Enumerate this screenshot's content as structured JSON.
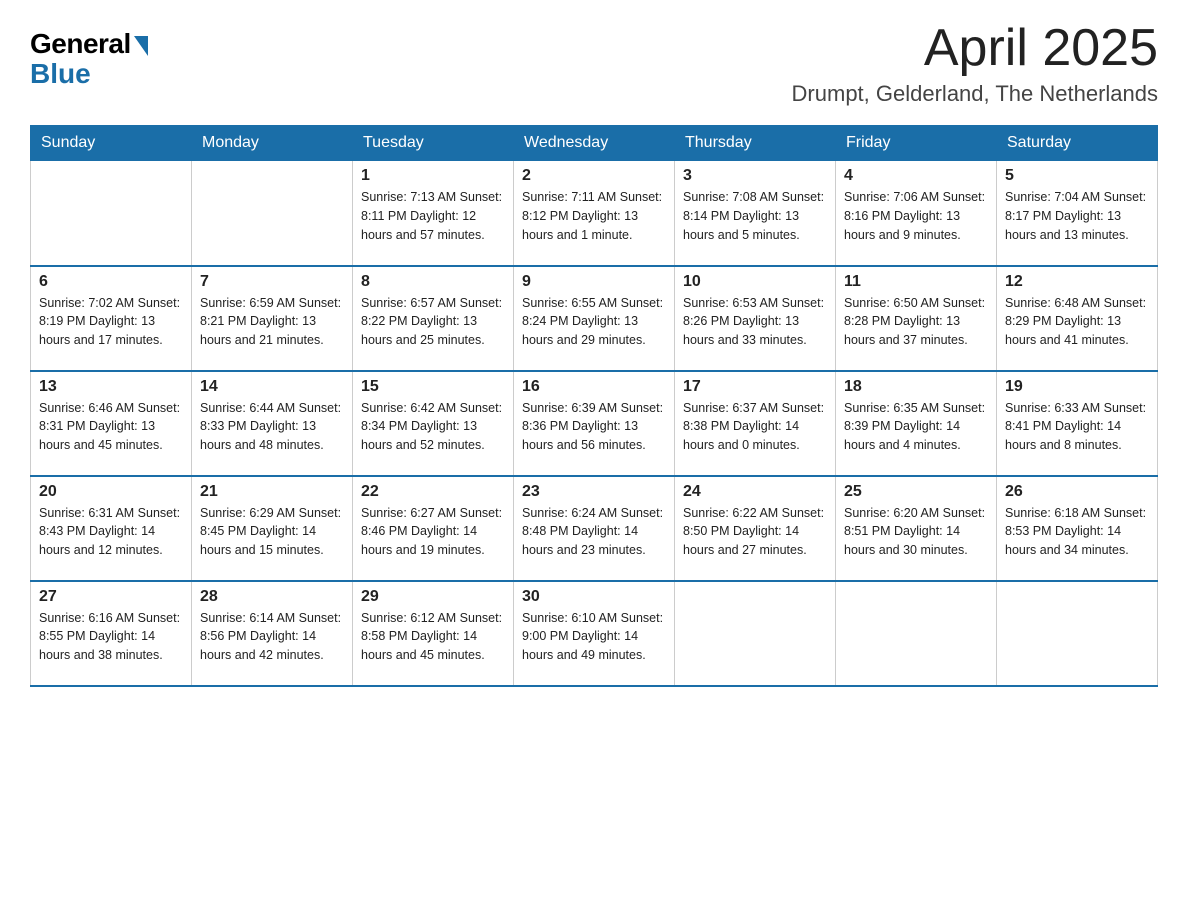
{
  "logo": {
    "general": "General",
    "blue": "Blue"
  },
  "title": "April 2025",
  "location": "Drumpt, Gelderland, The Netherlands",
  "weekdays": [
    "Sunday",
    "Monday",
    "Tuesday",
    "Wednesday",
    "Thursday",
    "Friday",
    "Saturday"
  ],
  "weeks": [
    [
      {
        "day": "",
        "info": ""
      },
      {
        "day": "",
        "info": ""
      },
      {
        "day": "1",
        "info": "Sunrise: 7:13 AM\nSunset: 8:11 PM\nDaylight: 12 hours\nand 57 minutes."
      },
      {
        "day": "2",
        "info": "Sunrise: 7:11 AM\nSunset: 8:12 PM\nDaylight: 13 hours\nand 1 minute."
      },
      {
        "day": "3",
        "info": "Sunrise: 7:08 AM\nSunset: 8:14 PM\nDaylight: 13 hours\nand 5 minutes."
      },
      {
        "day": "4",
        "info": "Sunrise: 7:06 AM\nSunset: 8:16 PM\nDaylight: 13 hours\nand 9 minutes."
      },
      {
        "day": "5",
        "info": "Sunrise: 7:04 AM\nSunset: 8:17 PM\nDaylight: 13 hours\nand 13 minutes."
      }
    ],
    [
      {
        "day": "6",
        "info": "Sunrise: 7:02 AM\nSunset: 8:19 PM\nDaylight: 13 hours\nand 17 minutes."
      },
      {
        "day": "7",
        "info": "Sunrise: 6:59 AM\nSunset: 8:21 PM\nDaylight: 13 hours\nand 21 minutes."
      },
      {
        "day": "8",
        "info": "Sunrise: 6:57 AM\nSunset: 8:22 PM\nDaylight: 13 hours\nand 25 minutes."
      },
      {
        "day": "9",
        "info": "Sunrise: 6:55 AM\nSunset: 8:24 PM\nDaylight: 13 hours\nand 29 minutes."
      },
      {
        "day": "10",
        "info": "Sunrise: 6:53 AM\nSunset: 8:26 PM\nDaylight: 13 hours\nand 33 minutes."
      },
      {
        "day": "11",
        "info": "Sunrise: 6:50 AM\nSunset: 8:28 PM\nDaylight: 13 hours\nand 37 minutes."
      },
      {
        "day": "12",
        "info": "Sunrise: 6:48 AM\nSunset: 8:29 PM\nDaylight: 13 hours\nand 41 minutes."
      }
    ],
    [
      {
        "day": "13",
        "info": "Sunrise: 6:46 AM\nSunset: 8:31 PM\nDaylight: 13 hours\nand 45 minutes."
      },
      {
        "day": "14",
        "info": "Sunrise: 6:44 AM\nSunset: 8:33 PM\nDaylight: 13 hours\nand 48 minutes."
      },
      {
        "day": "15",
        "info": "Sunrise: 6:42 AM\nSunset: 8:34 PM\nDaylight: 13 hours\nand 52 minutes."
      },
      {
        "day": "16",
        "info": "Sunrise: 6:39 AM\nSunset: 8:36 PM\nDaylight: 13 hours\nand 56 minutes."
      },
      {
        "day": "17",
        "info": "Sunrise: 6:37 AM\nSunset: 8:38 PM\nDaylight: 14 hours\nand 0 minutes."
      },
      {
        "day": "18",
        "info": "Sunrise: 6:35 AM\nSunset: 8:39 PM\nDaylight: 14 hours\nand 4 minutes."
      },
      {
        "day": "19",
        "info": "Sunrise: 6:33 AM\nSunset: 8:41 PM\nDaylight: 14 hours\nand 8 minutes."
      }
    ],
    [
      {
        "day": "20",
        "info": "Sunrise: 6:31 AM\nSunset: 8:43 PM\nDaylight: 14 hours\nand 12 minutes."
      },
      {
        "day": "21",
        "info": "Sunrise: 6:29 AM\nSunset: 8:45 PM\nDaylight: 14 hours\nand 15 minutes."
      },
      {
        "day": "22",
        "info": "Sunrise: 6:27 AM\nSunset: 8:46 PM\nDaylight: 14 hours\nand 19 minutes."
      },
      {
        "day": "23",
        "info": "Sunrise: 6:24 AM\nSunset: 8:48 PM\nDaylight: 14 hours\nand 23 minutes."
      },
      {
        "day": "24",
        "info": "Sunrise: 6:22 AM\nSunset: 8:50 PM\nDaylight: 14 hours\nand 27 minutes."
      },
      {
        "day": "25",
        "info": "Sunrise: 6:20 AM\nSunset: 8:51 PM\nDaylight: 14 hours\nand 30 minutes."
      },
      {
        "day": "26",
        "info": "Sunrise: 6:18 AM\nSunset: 8:53 PM\nDaylight: 14 hours\nand 34 minutes."
      }
    ],
    [
      {
        "day": "27",
        "info": "Sunrise: 6:16 AM\nSunset: 8:55 PM\nDaylight: 14 hours\nand 38 minutes."
      },
      {
        "day": "28",
        "info": "Sunrise: 6:14 AM\nSunset: 8:56 PM\nDaylight: 14 hours\nand 42 minutes."
      },
      {
        "day": "29",
        "info": "Sunrise: 6:12 AM\nSunset: 8:58 PM\nDaylight: 14 hours\nand 45 minutes."
      },
      {
        "day": "30",
        "info": "Sunrise: 6:10 AM\nSunset: 9:00 PM\nDaylight: 14 hours\nand 49 minutes."
      },
      {
        "day": "",
        "info": ""
      },
      {
        "day": "",
        "info": ""
      },
      {
        "day": "",
        "info": ""
      }
    ]
  ]
}
